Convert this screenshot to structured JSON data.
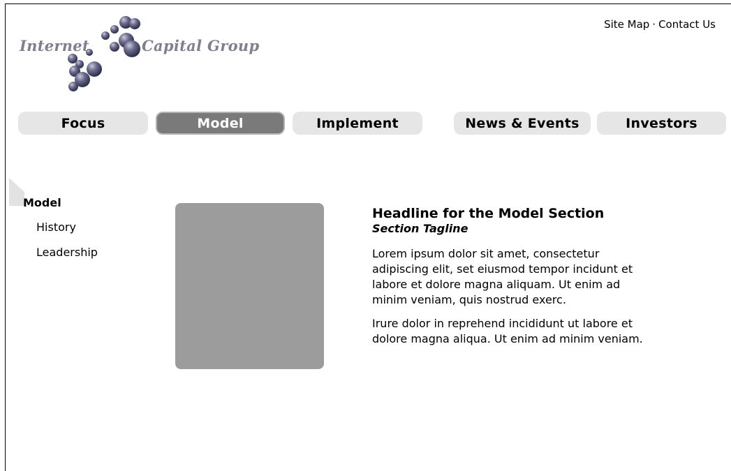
{
  "header": {
    "logo": {
      "word1": "Internet",
      "word2": "Capital Group",
      "sphere_color": "#5a5a7a"
    },
    "utility_links": {
      "site_map": "Site Map",
      "separator": "·",
      "contact_us": "Contact Us"
    }
  },
  "nav": {
    "tabs": [
      {
        "label": "Focus",
        "active": false
      },
      {
        "label": "Model",
        "active": true
      },
      {
        "label": "Implement",
        "active": false
      },
      {
        "label": "News & Events",
        "active": false
      },
      {
        "label": "Investors",
        "active": false
      }
    ],
    "tab_color": "#e6e6e6",
    "active_tab_color": "#7a7a7a"
  },
  "sidebar": {
    "title": "Model",
    "items": [
      {
        "label": "History"
      },
      {
        "label": "Leadership"
      }
    ]
  },
  "main": {
    "image_placeholder_color": "#9c9c9c",
    "headline": "Headline for the Model Section",
    "tagline": "Section Tagline",
    "paragraphs": [
      "Lorem ipsum dolor sit amet, consectetur adipiscing elit, set eiusmod tempor incidunt et labore et dolore magna aliquam. Ut enim ad minim veniam, quis nostrud exerc.",
      "Irure dolor in reprehend incididunt ut labore et dolore magna aliqua. Ut enim ad minim veniam."
    ]
  }
}
